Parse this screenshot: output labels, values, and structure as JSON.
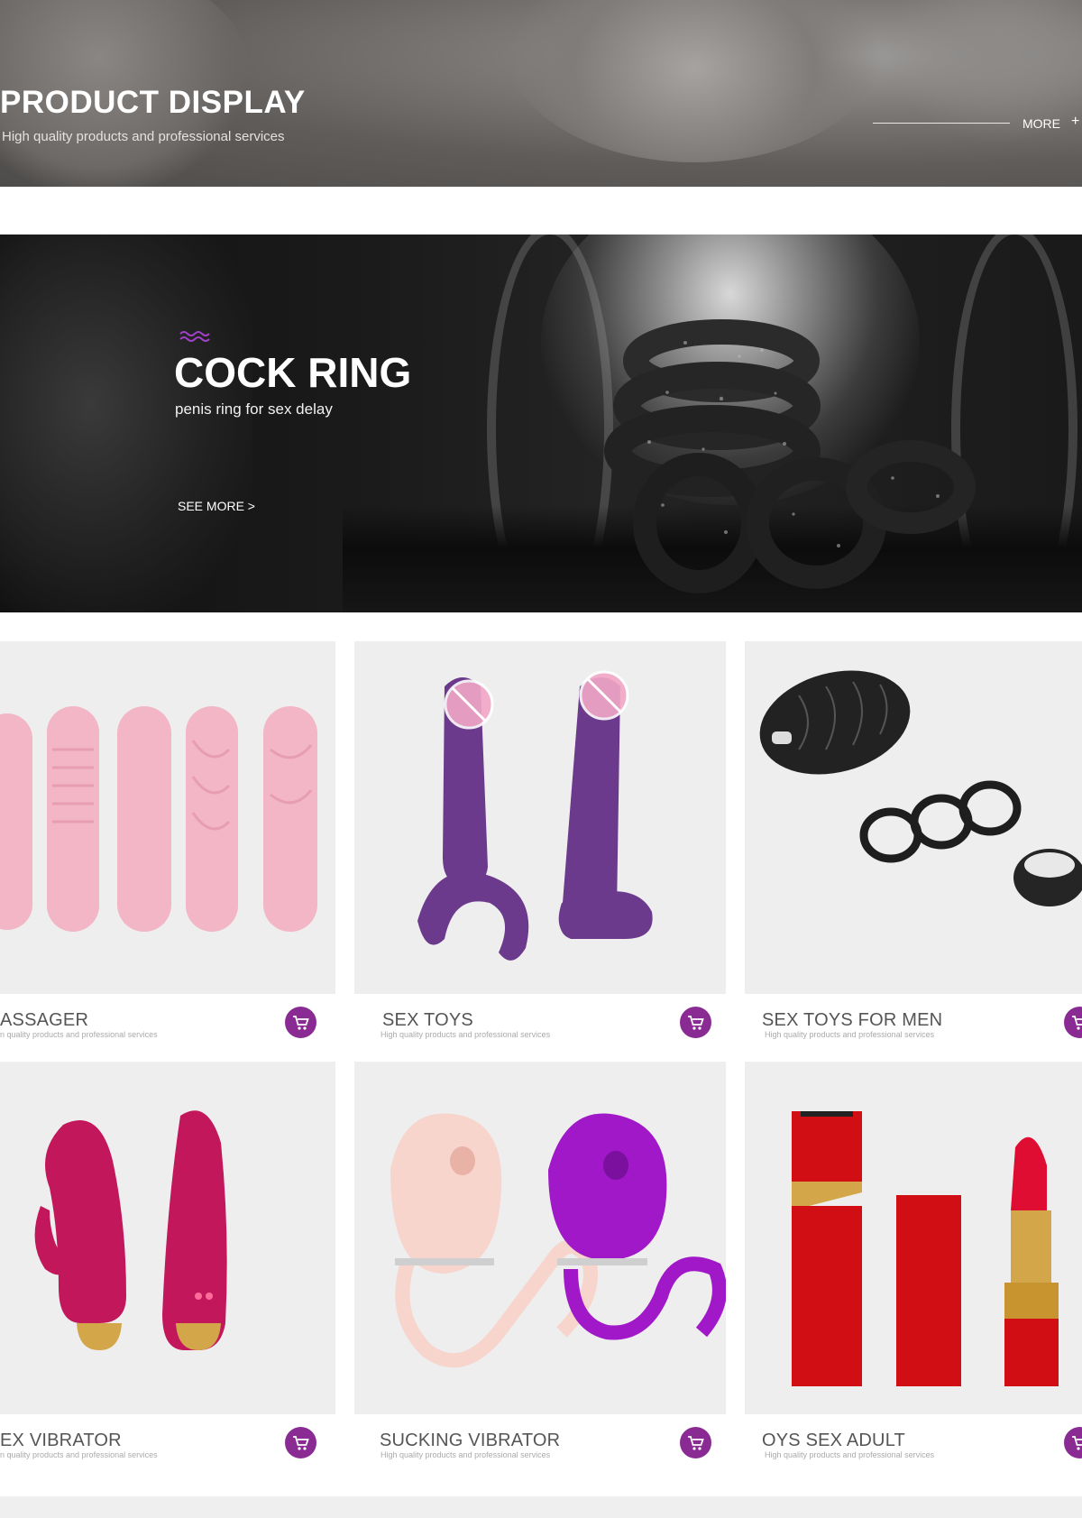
{
  "header": {
    "title": "PRODUCT DISPLAY",
    "subtitle": "High quality products and professional services",
    "more_label": "MORE",
    "more_plus": "+"
  },
  "banner": {
    "icon": "wave-icon",
    "title": "COCK RING",
    "subtitle": "penis ring for sex delay",
    "see_more": "SEE MORE >"
  },
  "products": [
    {
      "name": "ASSAGER",
      "subtitle": "n quality products and professional services",
      "icon": "cart-icon"
    },
    {
      "name": "SEX TOYS",
      "subtitle": "High quality products and professional services",
      "icon": "cart-icon"
    },
    {
      "name": "SEX TOYS FOR MEN",
      "subtitle": "High quality products and professional services",
      "icon": "cart-icon"
    },
    {
      "name": "EX VIBRATOR",
      "subtitle": "n quality products and professional services",
      "icon": "cart-icon"
    },
    {
      "name": "SUCKING VIBRATOR",
      "subtitle": "High quality products and professional services",
      "icon": "cart-icon"
    },
    {
      "name": "OYS SEX ADULT",
      "subtitle": "High quality products and professional services",
      "icon": "cart-icon"
    }
  ],
  "colors": {
    "accent": "#8a2b94",
    "card_image_bg": "#eeeeee",
    "banner_bg": "#1a1a1a",
    "wave_icon": "#a040c8"
  }
}
